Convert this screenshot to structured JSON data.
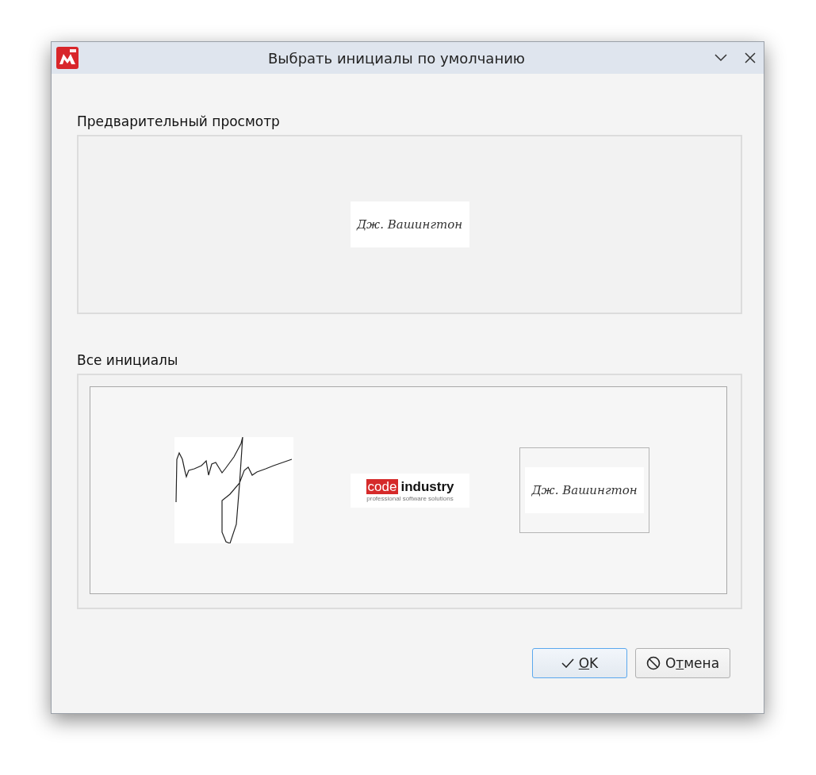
{
  "window": {
    "title": "Выбрать инициалы по умолчанию"
  },
  "preview": {
    "label": "Предварительный просмотр",
    "initials": {
      "kind": "text",
      "text": "Дж. Вашингтон"
    }
  },
  "all_initials": {
    "label": "Все инициалы",
    "items": [
      {
        "kind": "drawing",
        "selected": false
      },
      {
        "kind": "logo",
        "word_1": "code",
        "word_2": "industry",
        "tagline": "professional software solutions",
        "selected": false
      },
      {
        "kind": "text",
        "text": "Дж. Вашингтон",
        "selected": true
      }
    ]
  },
  "buttons": [
    {
      "kind": "ok",
      "mnemonic": "O",
      "after": "K",
      "default": true
    },
    {
      "kind": "cancel",
      "before": "О",
      "mnemonic": "т",
      "after": "мена",
      "default": false
    }
  ]
}
